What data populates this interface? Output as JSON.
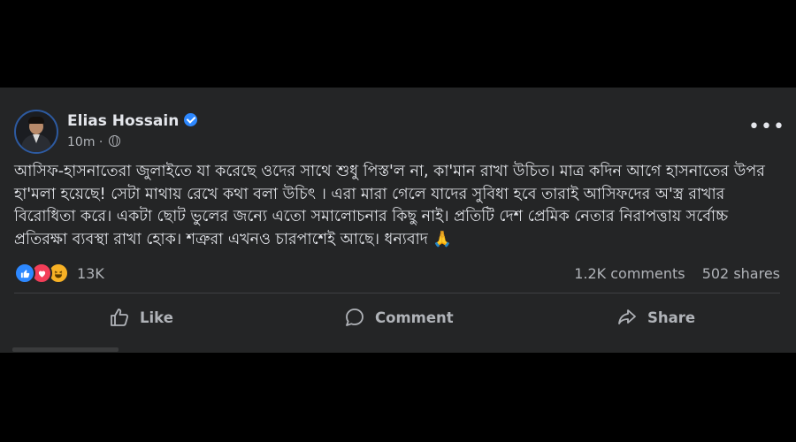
{
  "post": {
    "author": "Elias Hossain",
    "time": "10m",
    "separator": "·",
    "more_label": "•••",
    "text": "আসিফ-হাসনাতেরা জুলাইতে যা করেছে ওদের সাথে শুধু পিস্ত'ল না, কা'মান রাখা উচিত। মাত্র কদিন আগে হাসনাতের উপর হা'মলা হয়েছে! সেটা মাথায় রেখে কথা বলা উচিৎ । এরা মারা গেলে যাদের সুবিধা হবে তারাই আসিফদের অ'স্ত্র রাখার বিরোধিতা করে। একটা ছোট ভুলের জন্যে এতো সমালোচনার কিছু নাই। প্রতিটি দেশ প্রেমিক নেতার নিরাপত্তায় সর্বোচ্চ প্রতিরক্ষা ব্যবস্থা রাখা হোক। শত্রুরা এখনও চারপাশেই আছে। ধন্যবাদ 🙏",
    "reactions": {
      "count": "13K",
      "types": [
        "like",
        "love",
        "haha"
      ]
    },
    "comments": "1.2K comments",
    "shares": "502 shares",
    "actions": {
      "like": "Like",
      "comment": "Comment",
      "share": "Share"
    },
    "icons": {
      "verified": "verified-badge-icon",
      "privacy": "globe-icon",
      "more": "more-options-icon",
      "like": "thumbs-up-icon",
      "comment": "speech-bubble-icon",
      "share": "share-arrow-icon"
    },
    "colors": {
      "card_background": "#242526",
      "text": "#e4e6eb",
      "secondary_text": "#b0b3b8",
      "verified": "#2d88ff",
      "like": "#2d88ff",
      "love": "#f33e58",
      "haha": "#f7b125"
    }
  }
}
